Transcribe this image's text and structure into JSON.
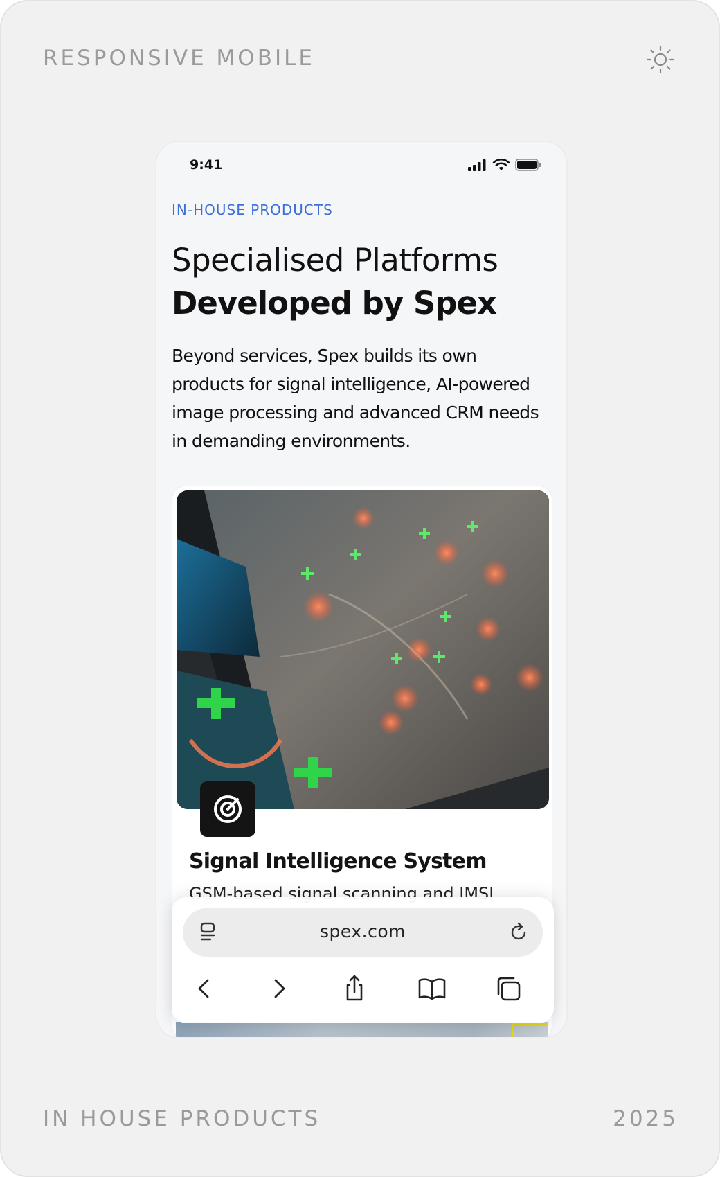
{
  "frame": {
    "top_left_label": "RESPONSIVE MOBILE",
    "bottom_left_label": "IN HOUSE PRODUCTS",
    "bottom_right_label": "2025",
    "theme_icon": "sun-icon"
  },
  "status_bar": {
    "time": "9:41",
    "icons": [
      "signal-icon",
      "wifi-icon",
      "battery-icon"
    ]
  },
  "section": {
    "eyebrow": "IN-HOUSE PRODUCTS",
    "title_light": "Specialised Platforms",
    "title_bold": "Developed by Spex",
    "description": "Beyond services, Spex builds its own products for signal intelligence, AI-powered image processing and advanced CRM needs in demanding environments."
  },
  "card": {
    "title": "Signal Intelligence System",
    "subtitle": "GSM-based signal scanning and IMSI",
    "logo_icon": "radar-icon"
  },
  "browser": {
    "url": "spex.com",
    "left_icon": "tabs-overview-icon",
    "right_icon": "reload-icon",
    "nav_icons": [
      "back-icon",
      "forward-icon",
      "share-icon",
      "bookmarks-icon",
      "tabs-icon"
    ]
  },
  "colors": {
    "accent": "#3e6fd8",
    "frame_bg": "#f1f1f1",
    "phone_bg": "#f5f6f8",
    "text": "#111111",
    "muted_label": "#9a9a9a"
  }
}
